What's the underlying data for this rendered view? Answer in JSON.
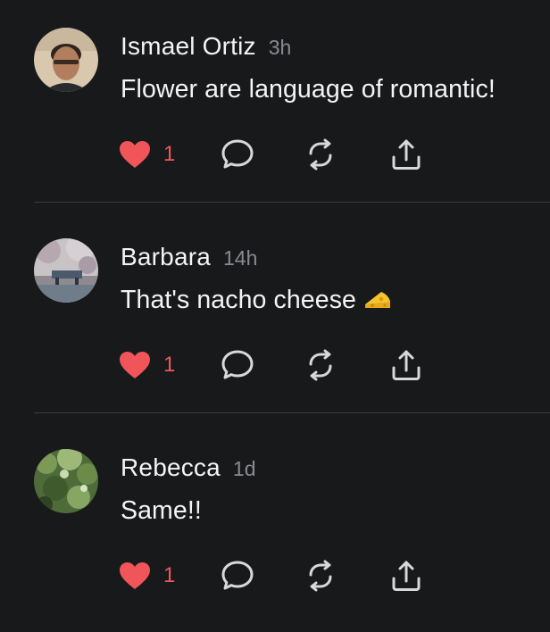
{
  "posts": [
    {
      "author": "Ismael Ortiz",
      "time": "3h",
      "text": "Flower are language of romantic!",
      "likes": "1",
      "avatar": "man-portrait"
    },
    {
      "author": "Barbara",
      "time": "14h",
      "text": "That's nacho cheese",
      "emoji": "cheese",
      "likes": "1",
      "avatar": "blossom-bridge"
    },
    {
      "author": "Rebecca",
      "time": "1d",
      "text": "Same!!",
      "likes": "1",
      "avatar": "green-foliage"
    }
  ],
  "icons": {
    "like": "heart-icon",
    "reply": "speech-bubble-icon",
    "repost": "repost-arrows-icon",
    "share": "share-icon"
  },
  "colors": {
    "background": "#18191b",
    "like": "#f0555a",
    "secondary_text": "#8a8b8f",
    "icon": "#d8d8da",
    "divider": "#3a3b3e"
  }
}
